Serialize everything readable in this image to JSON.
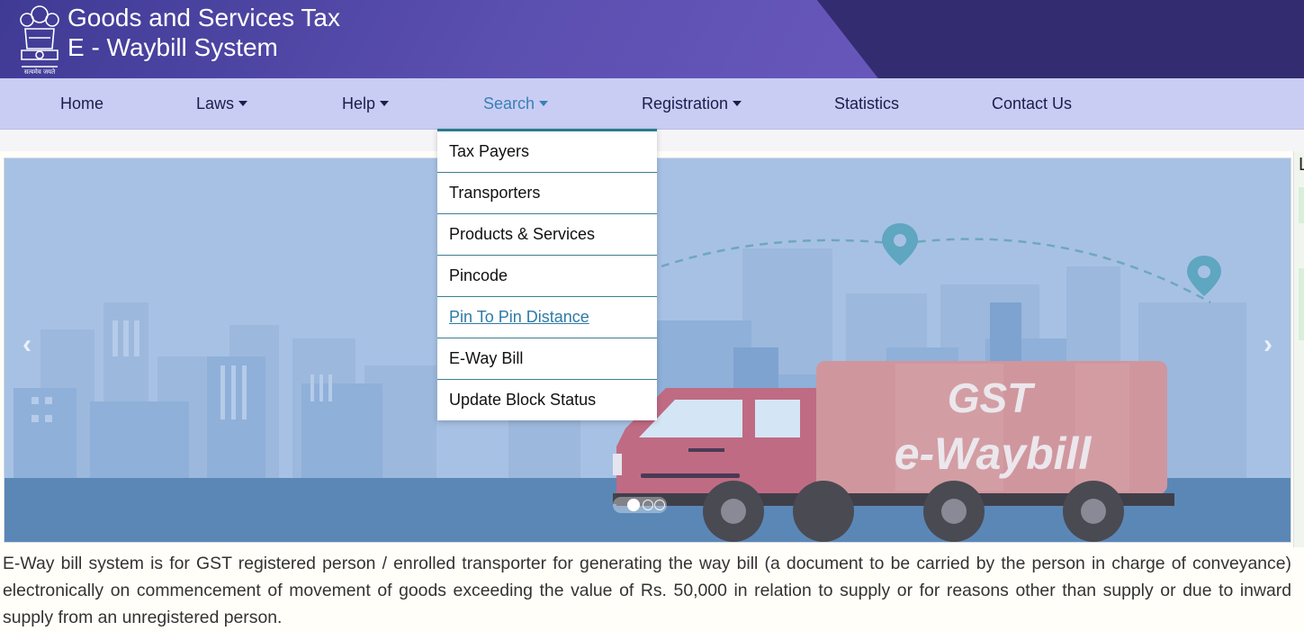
{
  "header": {
    "title_line1": "Goods and Services Tax",
    "title_line2": "E - Waybill System",
    "emblem_icon": "national-emblem-icon"
  },
  "nav": {
    "items": [
      {
        "label": "Home",
        "has_dropdown": false
      },
      {
        "label": "Laws",
        "has_dropdown": true
      },
      {
        "label": "Help",
        "has_dropdown": true
      },
      {
        "label": "Search",
        "has_dropdown": true,
        "active": true
      },
      {
        "label": "Registration",
        "has_dropdown": true
      },
      {
        "label": "Statistics",
        "has_dropdown": false
      },
      {
        "label": "Contact Us",
        "has_dropdown": false
      }
    ]
  },
  "search_dropdown": {
    "items": [
      {
        "label": "Tax Payers"
      },
      {
        "label": "Transporters"
      },
      {
        "label": "Products & Services"
      },
      {
        "label": "Pincode"
      },
      {
        "label": "Pin To Pin Distance",
        "hovered": true
      },
      {
        "label": "E-Way Bill"
      },
      {
        "label": "Update Block Status"
      }
    ]
  },
  "carousel": {
    "slide_text_line1": "GST",
    "slide_text_line2": "e-Waybill",
    "prev_icon": "chevron-left-icon",
    "next_icon": "chevron-right-icon",
    "indicator_count": 3,
    "active_indicator": 0
  },
  "right_panel": {
    "label": "L"
  },
  "description": "E-Way bill system is for GST registered person / enrolled transporter for generating the way bill (a document to be carried by the person in charge of conveyance) electronically on commencement of movement of goods exceeding the value of Rs. 50,000 in relation to supply or for reasons other than supply or due to inward supply from an unregistered person.",
  "colors": {
    "header_bg": "#4a3f9a",
    "nav_bg": "#c9cdf4",
    "nav_text": "#1d1d4d",
    "nav_active": "#3a80b3",
    "dropdown_border": "#3d7f8f",
    "link": "#2f7aa6",
    "truck_body": "#c06b84",
    "banner_bg": "#a7c1e4"
  }
}
